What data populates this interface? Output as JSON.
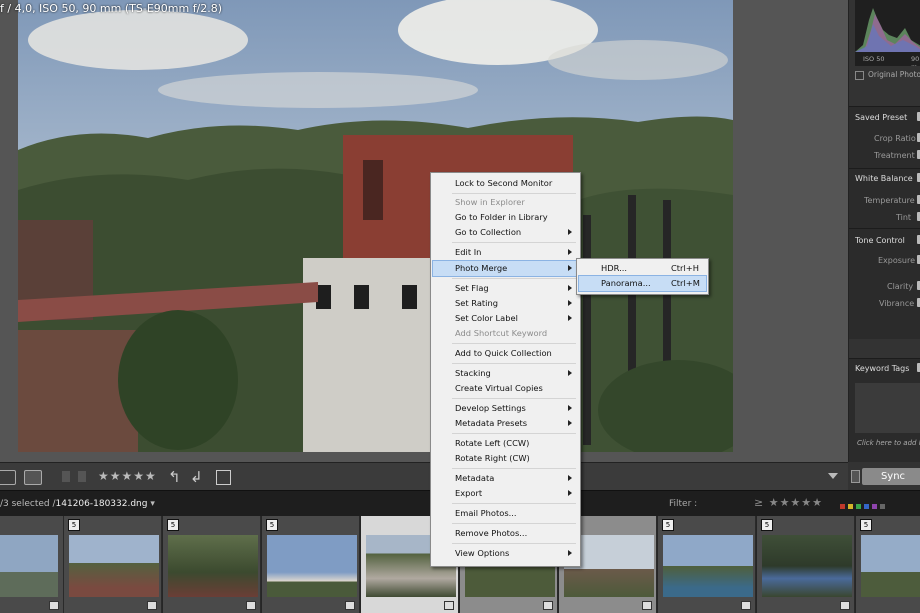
{
  "photo": {
    "info_overlay": "f / 4,0, ISO 50, 90 mm (TS-E90mm f/2.8)"
  },
  "histogram": {
    "iso": "ISO 50",
    "focal": "90 m"
  },
  "right_panel": {
    "original_photo": "Original Photo",
    "saved_preset": "Saved Preset",
    "crop_ratio": "Crop Ratio",
    "treatment": "Treatment",
    "white_balance": "White Balance",
    "temperature": "Temperature",
    "tint": "Tint",
    "tone_control": "Tone Control",
    "exposure": "Exposure",
    "clarity": "Clarity",
    "vibrance": "Vibrance",
    "keyword_tags": "Keyword Tags",
    "keyword_hint": "Click here to add ke",
    "sync": "Sync"
  },
  "toolbar": {
    "stars": "★★★★★"
  },
  "filmbar": {
    "selection_prefix": "/3 selected /",
    "filename": "141206-180332.dng",
    "filter_label": "Filter :",
    "filter_stars": "≥ ★★★★★"
  },
  "colors": {
    "labels": [
      "#c0392b",
      "#d4b52a",
      "#3aa64a",
      "#3566c8",
      "#8e44ad",
      "#666666"
    ]
  },
  "filmstrip": {
    "badges": [
      "5",
      "5",
      "5",
      "5",
      "5",
      "5",
      "5",
      "5",
      "5"
    ]
  },
  "context_menu": {
    "items": [
      {
        "label": "Lock to Second Monitor"
      },
      {
        "label": "Show in Explorer"
      },
      {
        "label": "Go to Folder in Library"
      },
      {
        "label": "Go to Collection"
      },
      {
        "label": "Edit In"
      },
      {
        "label": "Photo Merge"
      },
      {
        "label": "Set Flag"
      },
      {
        "label": "Set Rating"
      },
      {
        "label": "Set Color Label"
      },
      {
        "label": "Add Shortcut Keyword"
      },
      {
        "label": "Add to Quick Collection"
      },
      {
        "label": "Stacking"
      },
      {
        "label": "Create Virtual Copies"
      },
      {
        "label": "Develop Settings"
      },
      {
        "label": "Metadata Presets"
      },
      {
        "label": "Rotate Left (CCW)"
      },
      {
        "label": "Rotate Right (CW)"
      },
      {
        "label": "Metadata"
      },
      {
        "label": "Export"
      },
      {
        "label": "Email Photos..."
      },
      {
        "label": "Remove Photos..."
      },
      {
        "label": "View Options"
      }
    ]
  },
  "submenu": {
    "items": [
      {
        "label": "HDR...",
        "shortcut": "Ctrl+H"
      },
      {
        "label": "Panorama...",
        "shortcut": "Ctrl+M"
      }
    ]
  }
}
